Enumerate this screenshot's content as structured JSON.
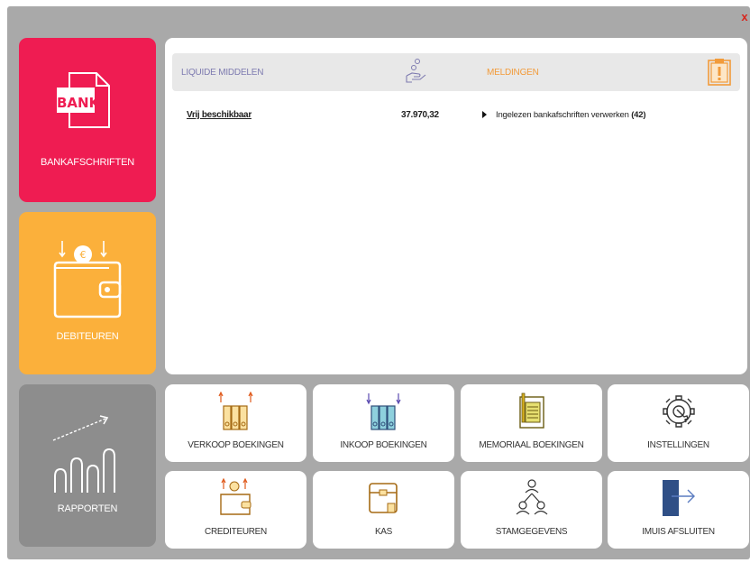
{
  "close_label": "x",
  "tiles": {
    "bank": {
      "label": "BANKAFSCHRIFTEN",
      "icon": "bank-document-icon",
      "badge": "BANK",
      "color": "#ef1c52"
    },
    "debiteuren": {
      "label": "DEBITEUREN",
      "icon": "wallet-icon",
      "color": "#fbb03b"
    },
    "rapporten": {
      "label": "RAPPORTEN",
      "icon": "bar-chart-icon",
      "color": "#8d8d8d"
    }
  },
  "panel": {
    "left_title": "LIQUIDE MIDDELEN",
    "right_title": "MELDINGEN",
    "rows": [
      {
        "label": "Vrij beschikbaar",
        "value": "37.970,32"
      }
    ],
    "notifications": [
      {
        "text": "Ingelezen bankafschriften verwerken",
        "count": "(42)"
      }
    ]
  },
  "buttons": [
    {
      "label": "VERKOOP BOEKINGEN",
      "icon": "binders-up-icon"
    },
    {
      "label": "INKOOP BOEKINGEN",
      "icon": "binders-down-icon"
    },
    {
      "label": "MEMORIAAL BOEKINGEN",
      "icon": "notepad-icon"
    },
    {
      "label": "INSTELLINGEN",
      "icon": "gear-wrench-icon"
    },
    {
      "label": "CREDITEUREN",
      "icon": "wallet-coin-icon"
    },
    {
      "label": "KAS",
      "icon": "cash-box-icon"
    },
    {
      "label": "STAMGEGEVENS",
      "icon": "people-icon"
    },
    {
      "label": "IMUIS AFSLUITEN",
      "icon": "exit-icon"
    }
  ]
}
